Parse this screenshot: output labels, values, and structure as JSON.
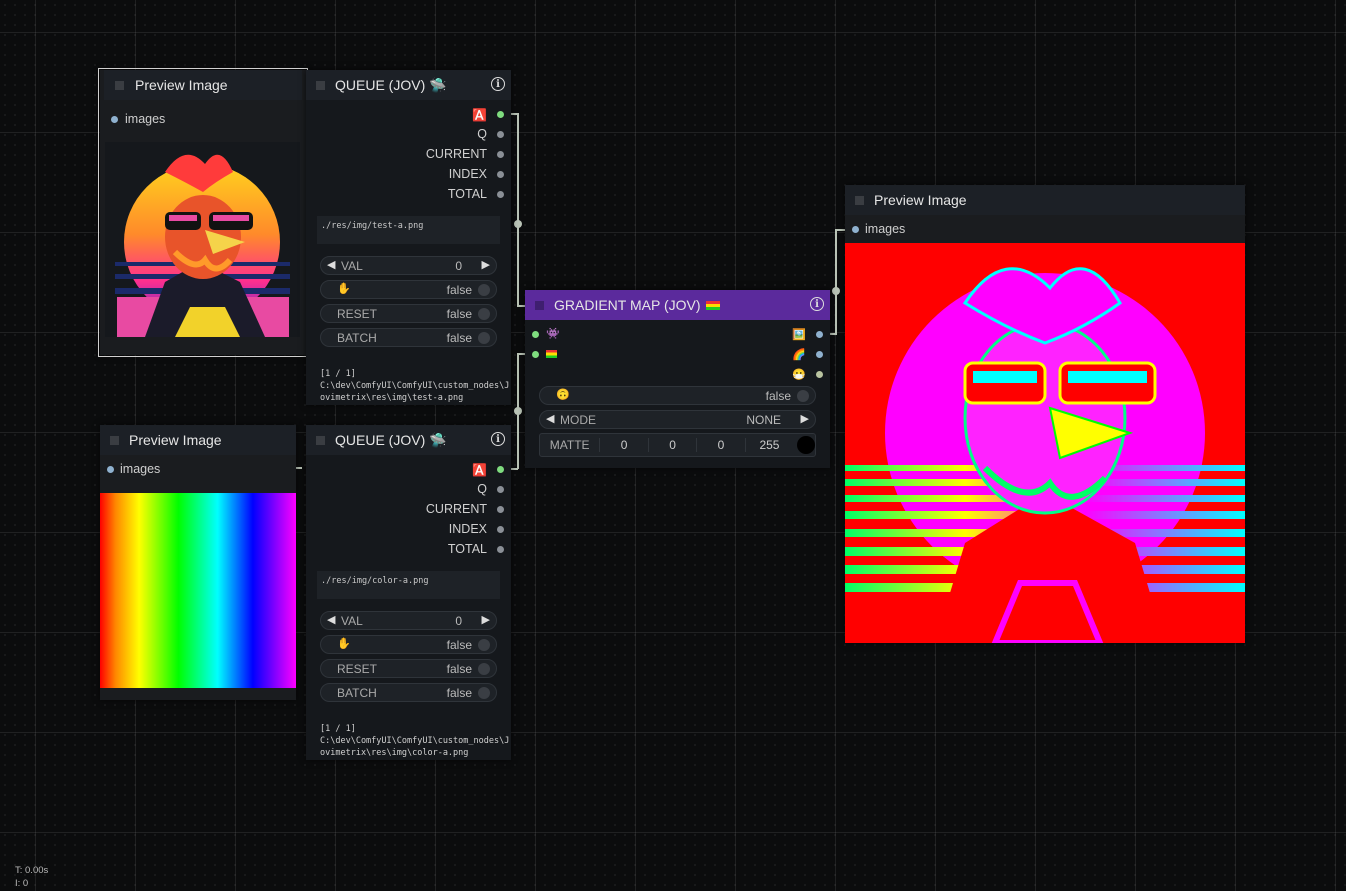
{
  "canvas": {
    "background": "#0b0c0d",
    "link_color": "#b9c3b6"
  },
  "preview1": {
    "title": "Preview Image",
    "input": "images"
  },
  "preview2": {
    "title": "Preview Image",
    "input": "images"
  },
  "preview3": {
    "title": "Preview Image",
    "input": "images"
  },
  "queue1": {
    "title": "QUEUE (JOV) 🛸",
    "outputs": [
      "Q",
      "CURRENT",
      "INDEX",
      "TOTAL"
    ],
    "path": "./res/img/test-a.png",
    "val_label": "VAL",
    "val_value": "0",
    "hold_value": "false",
    "reset_label": "RESET",
    "reset_value": "false",
    "batch_label": "BATCH",
    "batch_value": "false",
    "status_count": "[1 / 1]",
    "status_path_1": "C:\\dev\\ComfyUI\\ComfyUI\\custom_nodes\\J",
    "status_path_2": "ovimetrix\\res\\img\\test-a.png"
  },
  "queue2": {
    "title": "QUEUE (JOV) 🛸",
    "outputs": [
      "Q",
      "CURRENT",
      "INDEX",
      "TOTAL"
    ],
    "path": "./res/img/color-a.png",
    "val_label": "VAL",
    "val_value": "0",
    "hold_value": "false",
    "reset_label": "RESET",
    "reset_value": "false",
    "batch_label": "BATCH",
    "batch_value": "false",
    "status_count": "[1 / 1]",
    "status_path_1": "C:\\dev\\ComfyUI\\ComfyUI\\custom_nodes\\J",
    "status_path_2": "ovimetrix\\res\\img\\color-a.png"
  },
  "gradient": {
    "title": "GRADIENT MAP (JOV)",
    "title_color": "#5b2a9c",
    "flip_value": "false",
    "mode_label": "MODE",
    "mode_value": "NONE",
    "matte_label": "MATTE",
    "matte_values": [
      "0",
      "0",
      "0",
      "255"
    ]
  },
  "hud": {
    "time": "T: 0.00s",
    "iter": "I: 0"
  }
}
